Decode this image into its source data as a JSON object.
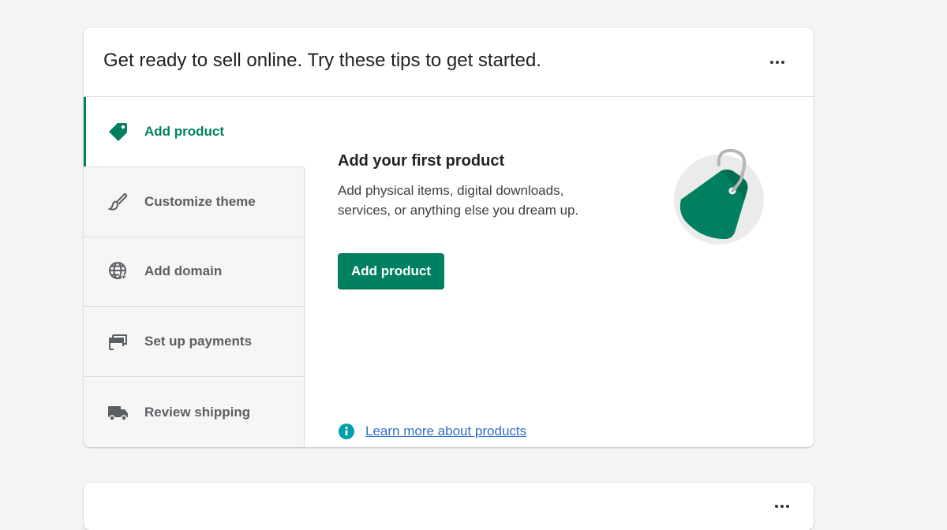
{
  "card": {
    "title": "Get ready to sell online. Try these tips to get started.",
    "menu_icon": "more-horizontal-icon"
  },
  "tabs": [
    {
      "label": "Add product",
      "icon": "tag-icon",
      "active": true
    },
    {
      "label": "Customize theme",
      "icon": "paintbrush-icon",
      "active": false
    },
    {
      "label": "Add domain",
      "icon": "globe-icon",
      "active": false
    },
    {
      "label": "Set up payments",
      "icon": "credit-card-icon",
      "active": false
    },
    {
      "label": "Review shipping",
      "icon": "truck-icon",
      "active": false
    }
  ],
  "content": {
    "title": "Add your first product",
    "description": "Add physical items, digital downloads, services, or anything else you dream up.",
    "button_label": "Add product",
    "illustration": "price-tag-illustration",
    "learn_more_label": "Learn more about products",
    "learn_more_icon": "info-icon"
  },
  "colors": {
    "accent": "#008060",
    "link": "#2c6ecb",
    "info": "#00a0ac",
    "tab_text": "#5c5f62",
    "page_bg": "#f4f4f4"
  },
  "second_card": {
    "menu_icon": "more-horizontal-icon"
  }
}
